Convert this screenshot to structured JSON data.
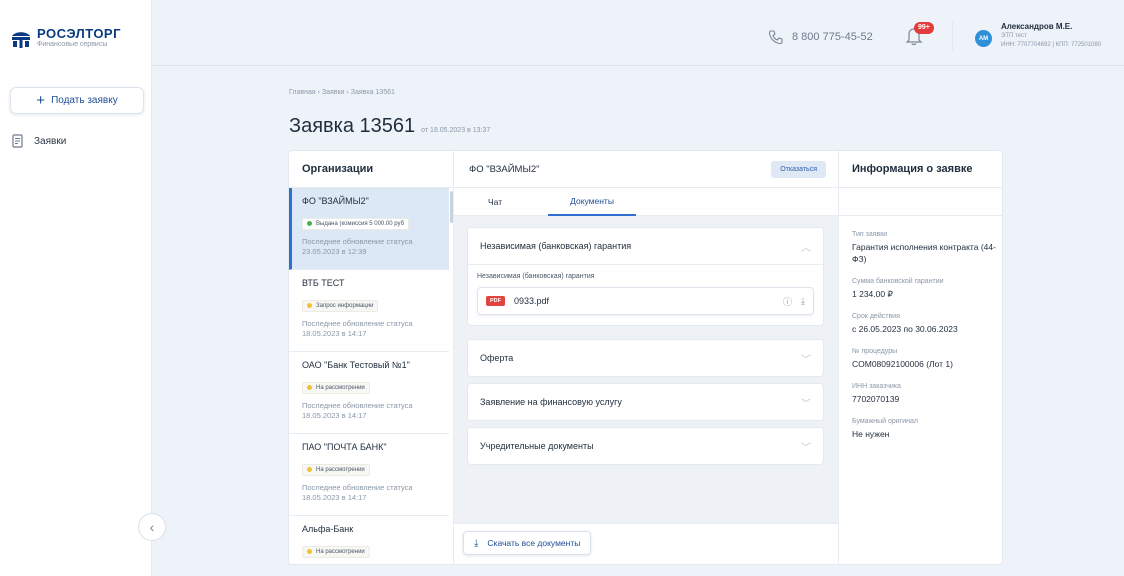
{
  "brand": {
    "title": "РОСЭЛТОРГ",
    "subtitle": "Финансовые сервисы"
  },
  "sidebar": {
    "new_button": "Подать заявку",
    "items": [
      {
        "label": "Заявки",
        "icon": "document-icon"
      }
    ],
    "collapse_icon": "chevron-left-icon"
  },
  "header": {
    "phone": "8 800 775-45-52",
    "notifications_badge": "99+",
    "user": {
      "initials": "АМ",
      "name": "Александров М.Е.",
      "role": "ЭТП тест",
      "details": "ИНН: 7707704692 | КПП: 772501080"
    }
  },
  "breadcrumb": [
    "Главная",
    "Заявки",
    "Заявка 13561"
  ],
  "page": {
    "title": "Заявка 13561",
    "date": "от 18.05.2023 в 13:37"
  },
  "orgs": {
    "heading": "Организации",
    "items": [
      {
        "name": "ФО \"ВЗАЙМЫ2\"",
        "status": "Выдана (комиссия 5 000.00 руб",
        "status_color": "#4caf50",
        "updated": "Последнее обновление статуса 23.05.2023 в 12:39",
        "active": true
      },
      {
        "name": "ВТБ ТЕСТ",
        "status": "Запрос информации",
        "status_color": "#f2c230",
        "updated": "Последнее обновление статуса 18.05.2023 в 14:17"
      },
      {
        "name": "ОАО \"Банк Тестовый №1\"",
        "status": "На рассмотрении",
        "status_color": "#f2c230",
        "updated": "Последнее обновление статуса 18.05.2023 в 14:17"
      },
      {
        "name": "ПАО \"ПОЧТА БАНК\"",
        "status": "На рассмотрении",
        "status_color": "#f2c230",
        "updated": "Последнее обновление статуса 18.05.2023 в 14:17"
      },
      {
        "name": "Альфа-Банк",
        "status": "На рассмотрении",
        "status_color": "#f2c230",
        "updated": ""
      }
    ]
  },
  "main": {
    "org_title": "ФО \"ВЗАЙМЫ2\"",
    "reject_button": "Отказаться",
    "tabs": [
      "Чат",
      "Документы"
    ],
    "accordions": [
      {
        "title": "Независимая (банковская) гарантия",
        "expanded": true,
        "label": "Независимая (банковская) гарантия",
        "file": {
          "type": "PDF",
          "name": "0933.pdf"
        }
      },
      {
        "title": "Оферта"
      },
      {
        "title": "Заявление на финансовую услугу"
      },
      {
        "title": "Учредительные документы"
      }
    ],
    "download_all": "Скачать все документы"
  },
  "info": {
    "heading": "Информация о заявке",
    "fields": [
      {
        "label": "Тип заявки",
        "value": "Гарантия исполнения контракта (44-ФЗ)"
      },
      {
        "label": "Сумма банковской гарантии",
        "value": "1 234.00 ₽"
      },
      {
        "label": "Срок действия",
        "value": "с 26.05.2023 по 30.06.2023"
      },
      {
        "label": "№ процедуры",
        "value": "COM08092100006 (Лот 1)"
      },
      {
        "label": "ИНН заказчика",
        "value": "7702070139"
      },
      {
        "label": "Бумажный оригинал",
        "value": "Не нужен"
      }
    ]
  },
  "colors": {
    "accent": "#2f6fd0",
    "brand": "#0a3b82",
    "alert": "#e23c3c"
  }
}
